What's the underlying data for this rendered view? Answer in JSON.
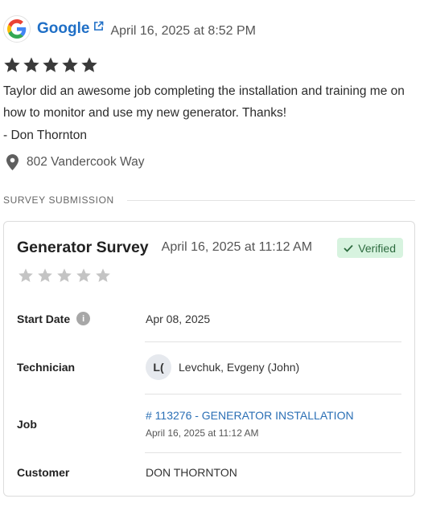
{
  "review": {
    "source": "Google",
    "date": "April 16, 2025 at 8:52 PM",
    "rating": 5,
    "text": "Taylor did an awesome job completing the installation and training me on how to monitor and use my new generator.  Thanks!",
    "signature": "- Don Thornton",
    "address": "802 Vandercook Way"
  },
  "section_title": "SURVEY SUBMISSION",
  "survey": {
    "title": "Generator Survey",
    "date": "April 16, 2025 at 11:12 AM",
    "verified_label": "Verified",
    "rating": 0,
    "fields": {
      "start_date": {
        "label": "Start Date",
        "value": "Apr 08, 2025"
      },
      "technician": {
        "label": "Technician",
        "initials": "L(",
        "name": "Levchuk, Evgeny (John)"
      },
      "job": {
        "label": "Job",
        "link": "# 113276 - GENERATOR INSTALLATION",
        "date": "April 16, 2025 at 11:12 AM"
      },
      "customer": {
        "label": "Customer",
        "value": "DON THORNTON"
      }
    }
  },
  "colors": {
    "link": "#1f6fc6",
    "star_filled": "#3a3a3a",
    "star_empty": "#c4c4c4",
    "verified_bg": "#d7f3df",
    "verified_text": "#2d6b3f"
  },
  "icons": [
    "google-logo",
    "external-link-icon",
    "star-icon",
    "map-pin-icon",
    "info-icon",
    "check-icon"
  ]
}
